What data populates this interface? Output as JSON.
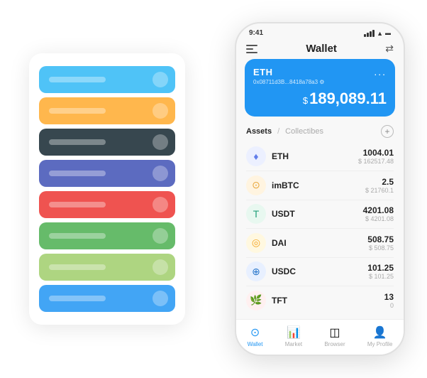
{
  "app": {
    "title": "Wallet"
  },
  "status_bar": {
    "time": "9:41",
    "battery": "●"
  },
  "header": {
    "title": "Wallet",
    "hamburger_label": "menu",
    "expand_label": "expand"
  },
  "wallet_card": {
    "label": "ETH",
    "address": "0x08711d3B...8418a78a3",
    "address_suffix": "⚙",
    "balance_prefix": "$",
    "balance": "189,089.11",
    "dots": "..."
  },
  "assets_section": {
    "active_tab": "Assets",
    "divider": "/",
    "inactive_tab": "Collectibes",
    "add_btn": "+"
  },
  "assets": [
    {
      "symbol": "ETH",
      "name": "ETH",
      "amount": "1004.01",
      "usd": "$ 162517.48",
      "icon": "♦",
      "icon_class": "eth-icon"
    },
    {
      "symbol": "imBTC",
      "name": "imBTC",
      "amount": "2.5",
      "usd": "$ 21760.1",
      "icon": "⊙",
      "icon_class": "imbtc-icon"
    },
    {
      "symbol": "USDT",
      "name": "USDT",
      "amount": "4201.08",
      "usd": "$ 4201.08",
      "icon": "T",
      "icon_class": "usdt-icon"
    },
    {
      "symbol": "DAI",
      "name": "DAI",
      "amount": "508.75",
      "usd": "$ 508.75",
      "icon": "◎",
      "icon_class": "dai-icon"
    },
    {
      "symbol": "USDC",
      "name": "USDC",
      "amount": "101.25",
      "usd": "$ 101.25",
      "icon": "⊕",
      "icon_class": "usdc-icon"
    },
    {
      "symbol": "TFT",
      "name": "TFT",
      "amount": "13",
      "usd": "0",
      "icon": "🌿",
      "icon_class": "tft-icon"
    }
  ],
  "bottom_nav": [
    {
      "label": "Wallet",
      "icon": "⊙",
      "active": true
    },
    {
      "label": "Market",
      "icon": "📈",
      "active": false
    },
    {
      "label": "Browser",
      "icon": "⊞",
      "active": false
    },
    {
      "label": "My Profile",
      "icon": "👤",
      "active": false
    }
  ],
  "card_stack": [
    {
      "color": "#4fc3f7"
    },
    {
      "color": "#ffb74d"
    },
    {
      "color": "#37474f"
    },
    {
      "color": "#5c6bc0"
    },
    {
      "color": "#ef5350"
    },
    {
      "color": "#66bb6a"
    },
    {
      "color": "#aed581"
    },
    {
      "color": "#42a5f5"
    }
  ]
}
